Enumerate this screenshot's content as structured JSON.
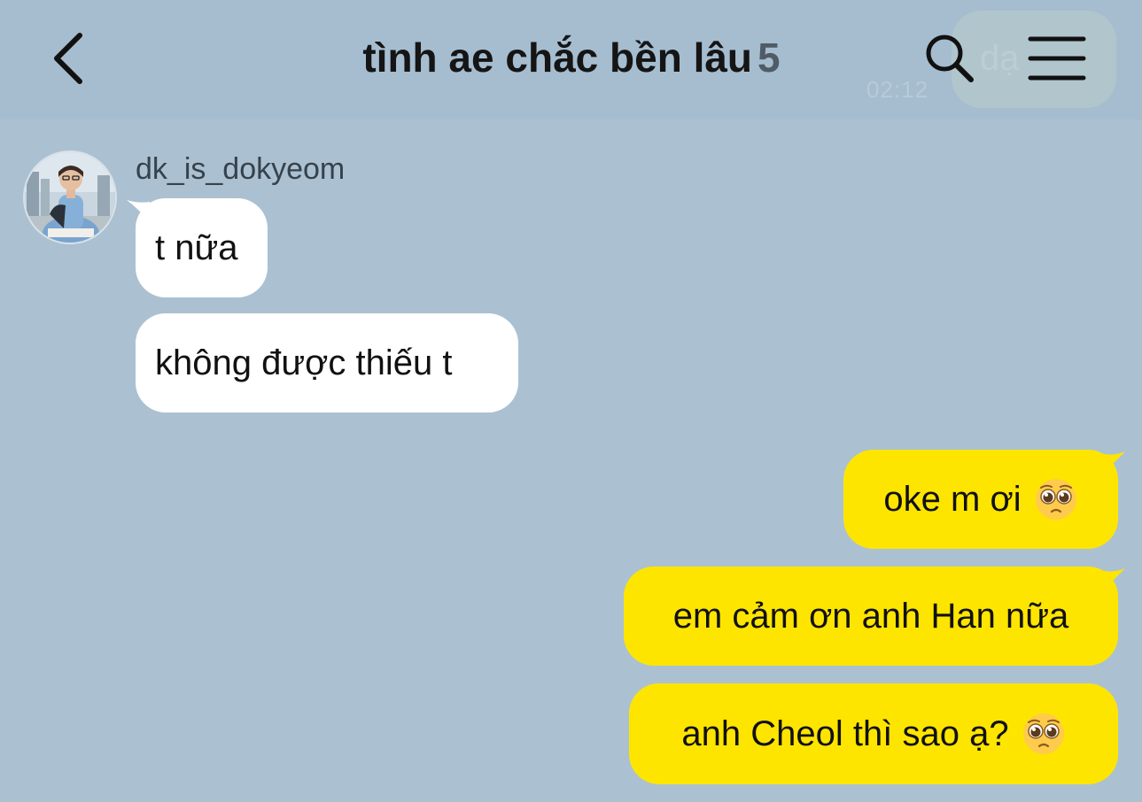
{
  "header": {
    "title": "tình ae chắc bền lâu",
    "member_count": "5",
    "ghost_preview_text": "dạ",
    "ghost_preview_time": "02:12"
  },
  "colors": {
    "background": "#abc1d1",
    "incoming_bubble": "#ffffff",
    "outgoing_bubble": "#fee500"
  },
  "icons": {
    "back": "chevron-left-icon",
    "search": "search-icon",
    "menu": "hamburger-menu-icon",
    "emoji": "pleading-face-emoji"
  },
  "messages": {
    "sender_name": "dk_is_dokyeom",
    "incoming": [
      {
        "text": "t nữa"
      },
      {
        "text": "không được thiếu t"
      }
    ],
    "outgoing": [
      {
        "text": "oke m ơi",
        "emoji": "pleading-face"
      },
      {
        "text": "em cảm ơn anh Han nữa"
      },
      {
        "text": "anh Cheol thì sao ạ?",
        "emoji": "pleading-face"
      }
    ]
  }
}
